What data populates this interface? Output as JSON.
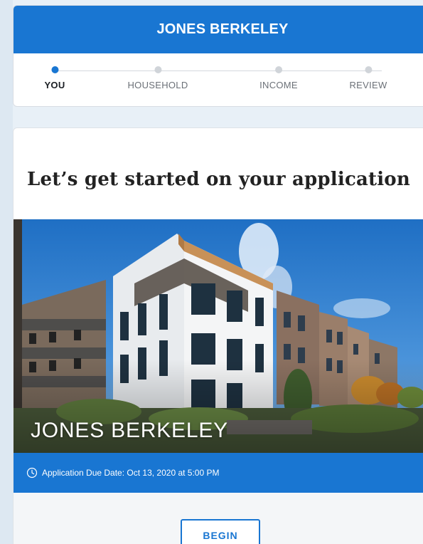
{
  "header": {
    "title": "JONES BERKELEY"
  },
  "stepper": {
    "steps": [
      {
        "label": "YOU",
        "active": true
      },
      {
        "label": "HOUSEHOLD",
        "active": false
      },
      {
        "label": "INCOME",
        "active": false
      },
      {
        "label": "REVIEW",
        "active": false
      }
    ]
  },
  "main": {
    "heading": "Let’s get started on your application",
    "hero_title": "JONES BERKELEY",
    "due_date_text": "Application Due Date: Oct 13, 2020 at 5:00 PM",
    "begin_label": "BEGIN"
  },
  "colors": {
    "primary": "#1976d2",
    "inactive_dot": "#d0d4d9",
    "background": "#f4f6f8"
  },
  "icons": {
    "due_date": "clock-icon"
  }
}
